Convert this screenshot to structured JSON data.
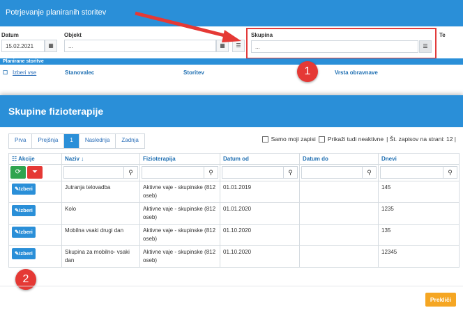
{
  "background": {
    "header_title": "Potrjevanje planiranih storitev",
    "datum_label": "Datum",
    "datum_value": "15.02.2021",
    "objekt_label": "Objekt",
    "objekt_placeholder": "...",
    "skupina_label": "Skupina",
    "skupina_placeholder": "...",
    "te_label": "Te",
    "subheader": "Planirane storitve",
    "columns": {
      "izberi_vse": "Izberi vse",
      "stanovalec": "Stanovalec",
      "storitev": "Storitev",
      "vrsta": "Vrsta obravnave"
    },
    "badge1": "1"
  },
  "dialog": {
    "title": "Skupine fizioterapije",
    "pager": [
      "Prva",
      "Prejšnja",
      "1",
      "Naslednja",
      "Zadnja"
    ],
    "opt_samo": "Samo moji zapisi",
    "opt_prikazi": "Prikaži tudi neaktivne",
    "opt_stevilo": "| Št. zapisov na strani: 12 |",
    "columns": [
      "Akcije",
      "Naziv ↓",
      "Fizioterapija",
      "Datum od",
      "Datum do",
      "Dnevi"
    ],
    "rows": [
      {
        "naziv": "Jutranja telovadba",
        "fizio": "Aktivne vaje - skupinske (812 oseb)",
        "od": "01.01.2019",
        "do": "",
        "dnevi": "145"
      },
      {
        "naziv": "Kolo",
        "fizio": "Aktivne vaje - skupinske (812 oseb)",
        "od": "01.01.2020",
        "do": "",
        "dnevi": "1235"
      },
      {
        "naziv": "Mobilna vsaki drugi dan",
        "fizio": "Aktivne vaje - skupinske (812 oseb)",
        "od": "01.10.2020",
        "do": "",
        "dnevi": "135"
      },
      {
        "naziv": "Skupina za mobilno- vsaki dan",
        "fizio": "Aktivne vaje - skupinske (812 oseb)",
        "od": "01.10.2020",
        "do": "",
        "dnevi": "12345"
      }
    ],
    "izberi_label": "Izberi",
    "cancel_label": "Prekliči",
    "badge2": "2"
  },
  "colors": {
    "primary": "#2a8fd8",
    "danger": "#e53935",
    "success": "#2fa44f",
    "warning": "#f5a623"
  },
  "icons": [
    "calendar-icon",
    "list-icon",
    "refresh-icon",
    "filter-clear-icon",
    "search-icon",
    "edit-icon",
    "columns-icon",
    "sort-icon"
  ]
}
